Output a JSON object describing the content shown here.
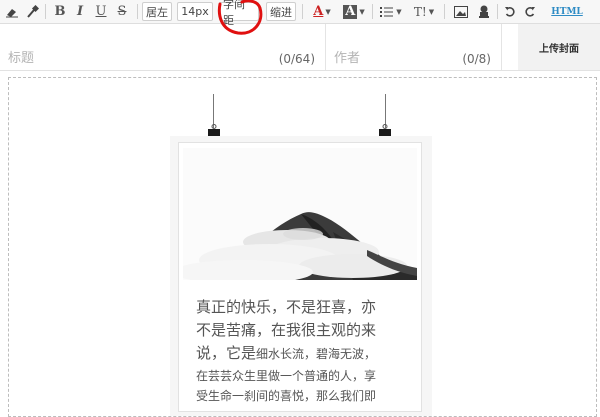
{
  "toolbar": {
    "align_left": "居左",
    "font_size": "14px",
    "letter_spacing": "字间距",
    "indent": "缩进",
    "bold": "B",
    "italic": "I",
    "underline": "U",
    "strike": "S",
    "font_color_glyph": "A",
    "bg_color_glyph": "A",
    "text_style_glyph": "T!",
    "html": "HTML",
    "accent_red": "#cc2222",
    "annotation_color": "#e01010"
  },
  "fields": {
    "title_placeholder": "标题",
    "title_count": "(0/64)",
    "author_placeholder": "作者",
    "author_count": "(0/8)"
  },
  "cover_button": "上传封面",
  "article": {
    "line1": "真正的快乐，不是狂喜，亦",
    "line2": "不是苦痛，在我很主观的来",
    "line3_big": "说，它是",
    "line3_small": "细水长流，碧海无波，",
    "line4": "在芸芸众生里做一个普通的人，享",
    "line5": "受生命一刹间的喜悦，那么我们即"
  }
}
